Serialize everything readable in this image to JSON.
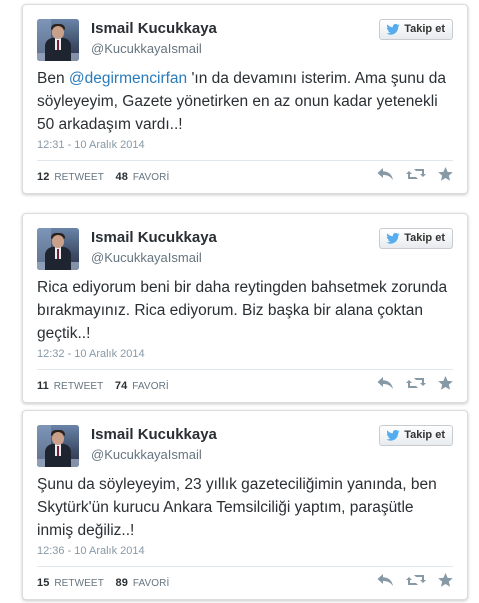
{
  "colors": {
    "link": "#2b7bb9",
    "text": "#292f33",
    "muted": "#8899a6",
    "twitter_blue": "#55acee",
    "action_gray": "#8899a6"
  },
  "tweets": [
    {
      "name": "Ismail Kucukkaya",
      "handle": "@KucukkayaIsmail",
      "follow_label": "Takip et",
      "text_before": "Ben ",
      "mention": "@degirmencirfan",
      "text_after": " 'ın da devamını isterim. Ama şunu da söyleyeyim, Gazete yönetirken en az onun kadar yetenekli 50 arkadaşım vardı..!",
      "timestamp": "12:31 - 10 Aralık 2014",
      "retweets": "12",
      "retweet_label": "RETWEET",
      "favorites": "48",
      "favorite_label": "FAVORİ",
      "icons": [
        "reply-icon",
        "retweet-icon",
        "favorite-star-icon"
      ]
    },
    {
      "name": "Ismail Kucukkaya",
      "handle": "@KucukkayaIsmail",
      "follow_label": "Takip et",
      "text": "Rica ediyorum beni bir daha reytingden bahsetmek zorunda bırakmayınız. Rica ediyorum. Biz başka bir alana çoktan geçtik..!",
      "timestamp": "12:32 - 10 Aralık 2014",
      "retweets": "11",
      "retweet_label": "RETWEET",
      "favorites": "74",
      "favorite_label": "FAVORİ",
      "icons": [
        "reply-icon",
        "retweet-icon",
        "favorite-star-icon"
      ]
    },
    {
      "name": "Ismail Kucukkaya",
      "handle": "@KucukkayaIsmail",
      "follow_label": "Takip et",
      "text": "Şunu da söyleyeyim, 23 yıllık gazeteciliğimin yanında, ben Skytürk'ün kurucu Ankara Temsilciliği yaptım, paraşütle inmiş değiliz..!",
      "timestamp": "12:36 - 10 Aralık 2014",
      "retweets": "15",
      "retweet_label": "RETWEET",
      "favorites": "89",
      "favorite_label": "FAVORİ",
      "icons": [
        "reply-icon",
        "retweet-icon",
        "favorite-star-icon"
      ]
    }
  ]
}
